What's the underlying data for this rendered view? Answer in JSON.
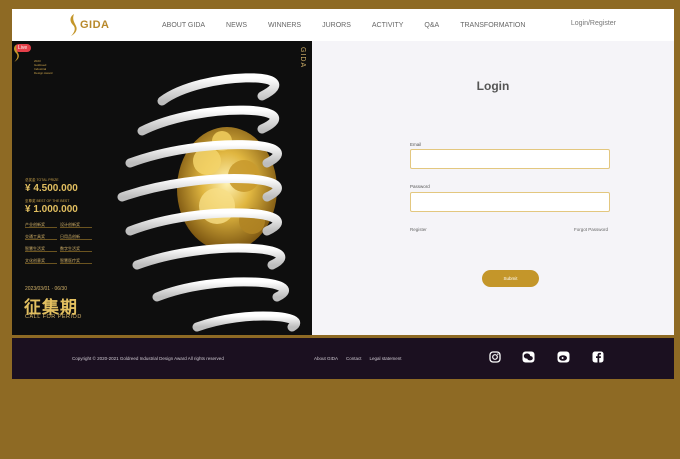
{
  "header": {
    "logo_text": "GIDA",
    "nav": [
      "ABOUT GIDA",
      "NEWS",
      "WINNERS",
      "JURORS",
      "ACTIVITY",
      "Q&A",
      "TRANSFORMATION"
    ],
    "login_register": "Login/Register"
  },
  "hero": {
    "live_badge": "Live",
    "vertical_text": "GIDA",
    "logo_lines": [
      "2023",
      "Goldreed",
      "Industrial",
      "Design Award"
    ],
    "total_prize_label": "总奖金 TOTAL PRIZE",
    "total_prize_value": "¥ 4.500.000",
    "best_label": "至尊奖 BEST OF THE BEST",
    "best_value": "¥ 1.000.000",
    "categories": [
      "产业创新奖",
      "设计创新奖",
      "交通工具奖",
      "日用品创新",
      "智慧生活奖",
      "数字生活奖",
      "文化创意奖",
      "智慧医疗奖"
    ],
    "date_range": "2023/03/01 · 06/30",
    "big_text": "征集期",
    "call_text": "CALL FOR PERIOD"
  },
  "login": {
    "title": "Login",
    "email_label": "Email",
    "email_value": "",
    "password_label": "Password",
    "password_value": "",
    "register": "Register",
    "forgot": "Forgot Password",
    "submit": "Submit"
  },
  "footer": {
    "copyright": "Copyright © 2020-2021 Goldreed Industrial Design Award All rights reserved",
    "links": [
      "About GIDA",
      "Contact",
      "Legal statement"
    ],
    "social": [
      "instagram-icon",
      "wechat-icon",
      "weibo-icon",
      "facebook-icon"
    ]
  },
  "colors": {
    "gold": "#c4962a",
    "footer_bg": "#1b1020",
    "frame_bg": "#8e6a24"
  }
}
